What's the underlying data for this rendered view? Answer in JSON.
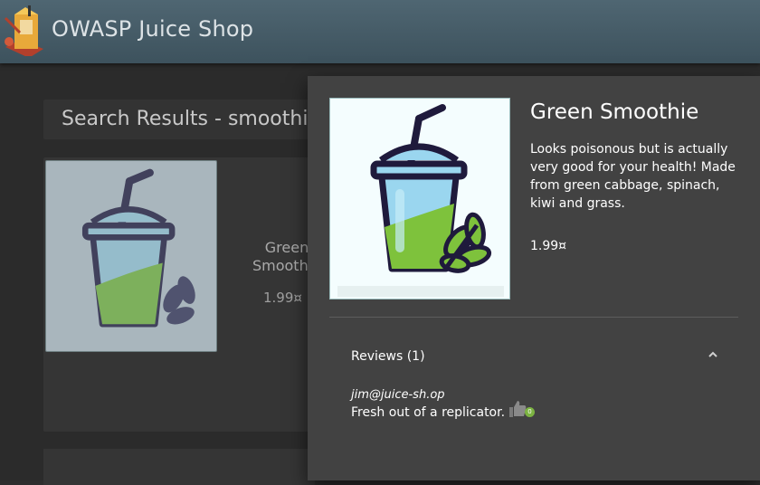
{
  "app": {
    "title": "OWASP Juice Shop"
  },
  "search": {
    "heading": "Search Results - smoothie"
  },
  "card": {
    "name": "Green Smoothie",
    "price": "1.99¤"
  },
  "dialog": {
    "name": "Green Smoothie",
    "description": "Looks poisonous but is actually very good for your health! Made from green cabbage, spinach, kiwi and grass.",
    "price": "1.99¤",
    "reviews_label": "Reviews (1)",
    "reviews": [
      {
        "author": "jim@juice-sh.op",
        "text": "Fresh out of a replicator.",
        "likes": "0"
      }
    ]
  },
  "colors": {
    "toolbar": "#46606c",
    "dialog": "#424242",
    "smoothie_green": "#7cb342",
    "cup_outline": "#1f1a3c"
  },
  "icons": {
    "logo": "juice-box-logo",
    "collapse": "chevron-up-icon",
    "like": "thumbs-up-icon"
  }
}
